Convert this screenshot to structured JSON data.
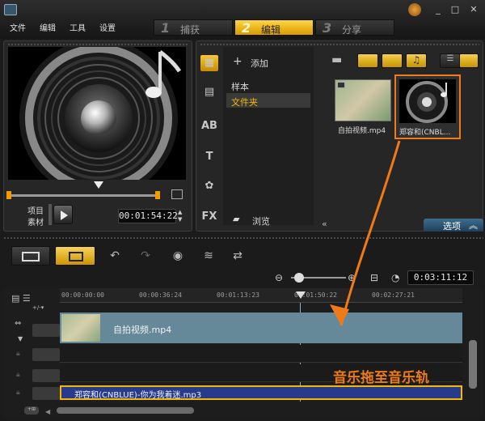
{
  "menu": {
    "file": "文件",
    "edit": "编辑",
    "tools": "工具",
    "settings": "设置"
  },
  "steps": [
    {
      "num": "1",
      "label": "捕获"
    },
    {
      "num": "2",
      "label": "编辑"
    },
    {
      "num": "3",
      "label": "分享"
    }
  ],
  "preview": {
    "mode_project": "项目",
    "mode_clip": "素材",
    "timecode": "00:01:54:22"
  },
  "library": {
    "add_label": "添加",
    "folders": [
      "样本",
      "文件夹"
    ],
    "browse_label": "浏览",
    "options_label": "选项",
    "thumbs": [
      {
        "caption": "自拍视频.mp4"
      },
      {
        "caption": "郑容和(CNBL..."
      }
    ]
  },
  "timeline": {
    "duration": "0:03:11:12",
    "ruler": [
      "00:00:00:00",
      "00:00:36:24",
      "00:01:13:23",
      "00:01:50:22",
      "00:02:27:21"
    ],
    "video_clip": "自拍视频.mp4",
    "music_clip": "郑容和(CNBLUE)-你为我着迷.mp3",
    "annotation": "音乐拖至音乐轨"
  },
  "colors": {
    "accent": "#f5b800",
    "annotation": "#f07a17",
    "music_track": "#273a8c",
    "video_track": "#5f8591"
  }
}
